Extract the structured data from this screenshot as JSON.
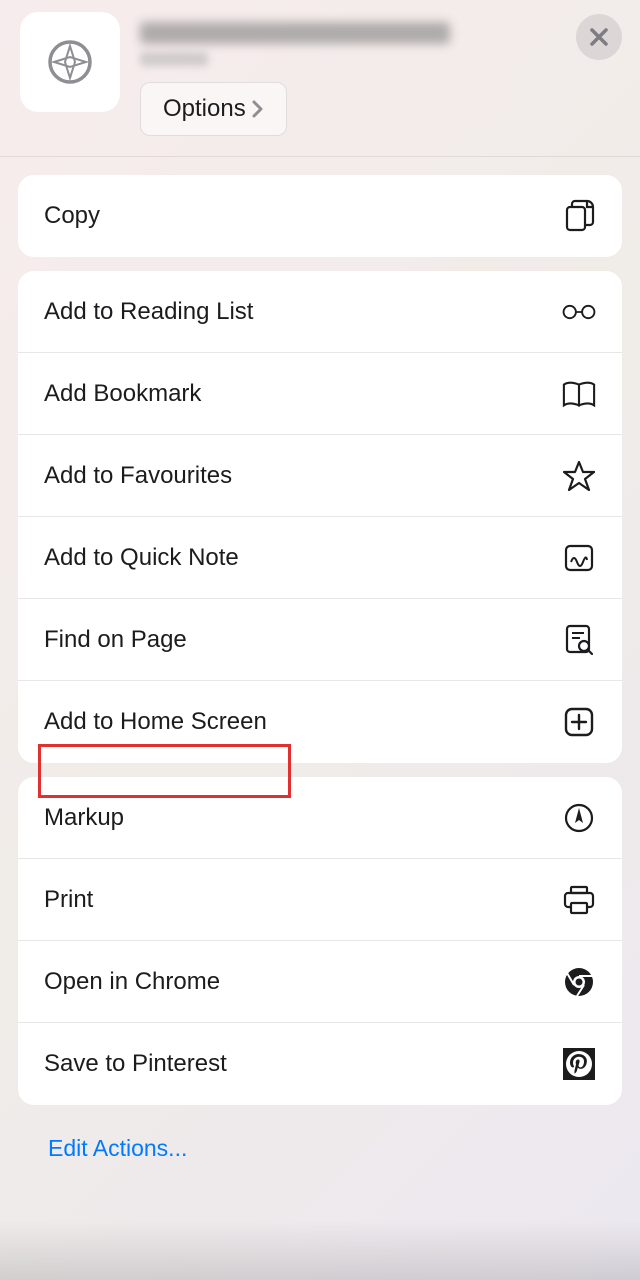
{
  "header": {
    "options_label": "Options"
  },
  "groups": [
    {
      "items": [
        {
          "label": "Copy",
          "icon": "copy-icon"
        }
      ]
    },
    {
      "items": [
        {
          "label": "Add to Reading List",
          "icon": "glasses-icon"
        },
        {
          "label": "Add Bookmark",
          "icon": "book-icon"
        },
        {
          "label": "Add to Favourites",
          "icon": "star-icon"
        },
        {
          "label": "Add to Quick Note",
          "icon": "quicknote-icon"
        },
        {
          "label": "Find on Page",
          "icon": "find-icon"
        },
        {
          "label": "Add to Home Screen",
          "icon": "plus-square-icon",
          "highlighted": true
        }
      ]
    },
    {
      "items": [
        {
          "label": "Markup",
          "icon": "markup-icon"
        },
        {
          "label": "Print",
          "icon": "print-icon"
        },
        {
          "label": "Open in Chrome",
          "icon": "chrome-icon"
        },
        {
          "label": "Save to Pinterest",
          "icon": "pinterest-icon"
        }
      ]
    }
  ],
  "footer": {
    "edit_actions_label": "Edit Actions..."
  }
}
